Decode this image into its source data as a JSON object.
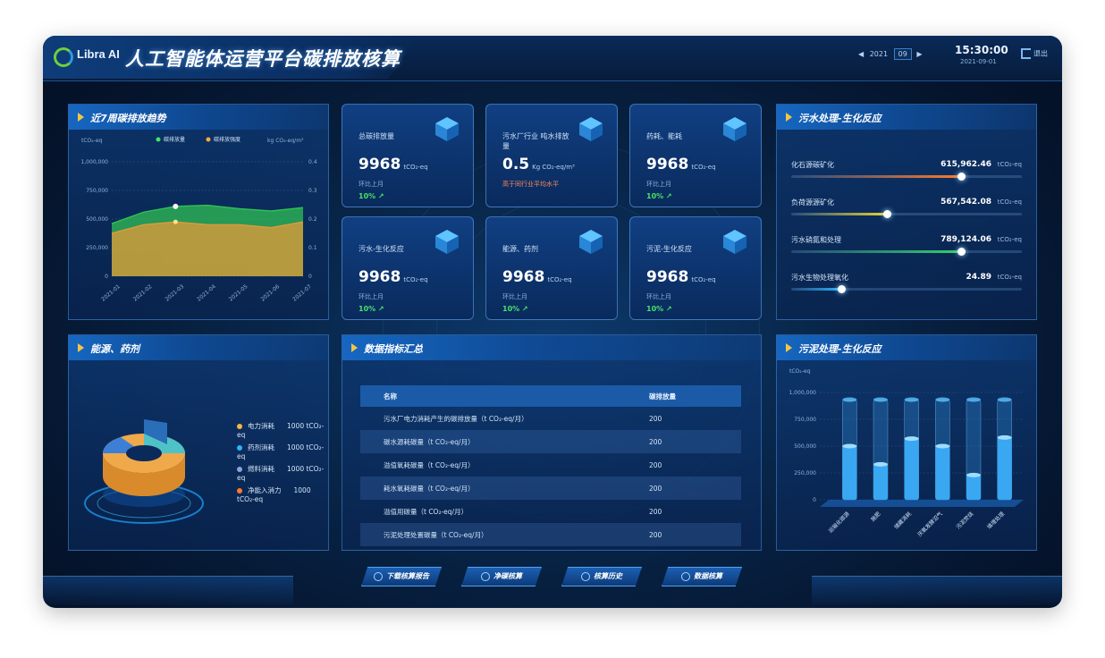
{
  "header": {
    "logo": "Libra AI",
    "title": "人工智能体运营平台碳排放核算",
    "date_prev": "◀",
    "date_year": "2021",
    "date_value": "09",
    "date_next": "▶",
    "time": "15:30:00",
    "date_sub": "2021-09-01",
    "exit_label": "退出"
  },
  "trend": {
    "title": "近7周碳排放趋势",
    "ylabel_left": "tCO₂-eq",
    "ylabel_right": "kg CO₂-eq/m³",
    "legend": [
      "碳排放量",
      "碳排放强度"
    ],
    "y_ticks_left": [
      "1,000,000",
      "750,000",
      "500,000",
      "250,000",
      "0"
    ],
    "y_ticks_right": [
      "0.4",
      "0.3",
      "0.2",
      "0.1",
      "0"
    ]
  },
  "chart_data": {
    "type": "area",
    "categories": [
      "2021-01",
      "2021-02",
      "2021-03",
      "2021-04",
      "2021-05",
      "2021-06",
      "2021-07"
    ],
    "series": [
      {
        "name": "碳排放量",
        "values": [
          460000,
          560000,
          610000,
          620000,
          590000,
          570000,
          600000
        ]
      },
      {
        "name": "碳排放强度",
        "values": [
          0.15,
          0.18,
          0.19,
          0.18,
          0.18,
          0.17,
          0.19
        ]
      }
    ],
    "ylim": [
      0,
      1000000
    ],
    "ylim_right": [
      0,
      0.4
    ]
  },
  "kpis": [
    {
      "label": "总碳排放量",
      "value": "9968",
      "unit": "tCO₂-eq",
      "compare": "环比上月",
      "pct": "10% ↗"
    },
    {
      "label": "污水厂行业 吨水排放量",
      "value": "0.5",
      "unit": "Kg CO₂-eq/m³",
      "compare": "高于同行业平均水平",
      "pct": ""
    },
    {
      "label": "药耗、能耗",
      "value": "9968",
      "unit": "tCO₂-eq",
      "compare": "环比上月",
      "pct": "10% ↗"
    },
    {
      "label": "污水-生化反应",
      "value": "9968",
      "unit": "tCO₂-eq",
      "compare": "环比上月",
      "pct": "10% ↗"
    },
    {
      "label": "能源、药剂",
      "value": "9968",
      "unit": "tCO₂-eq",
      "compare": "环比上月",
      "pct": "10% ↗"
    },
    {
      "label": "污泥-生化反应",
      "value": "9968",
      "unit": "tCO₂-eq",
      "compare": "环比上月",
      "pct": "10% ↗"
    }
  ],
  "water_panel": {
    "title": "污水处理-生化反应",
    "rows": [
      {
        "name": "化石源碳矿化",
        "value": "615,962.46",
        "unit": "tCO₂-eq",
        "fill": 0.74
      },
      {
        "name": "负荷源源矿化",
        "value": "567,542.08",
        "unit": "tCO₂-eq",
        "fill": 0.42
      },
      {
        "name": "污水硝氮和处理",
        "value": "789,124.06",
        "unit": "tCO₂-eq",
        "fill": 0.74
      },
      {
        "name": "污水生物处理氧化",
        "value": "24.89",
        "unit": "tCO₂-eq",
        "fill": 0.22
      }
    ]
  },
  "energy_panel": {
    "title": "能源、药剂",
    "legend": [
      {
        "name": "电力消耗",
        "value": "1000 tCO₂-eq"
      },
      {
        "name": "药剂消耗",
        "value": "1000 tCO₂-eq"
      },
      {
        "name": "燃料消耗",
        "value": "1000 tCO₂-eq"
      },
      {
        "name": "净能入消力",
        "value": "1000 tCO₂-eq"
      }
    ]
  },
  "summary": {
    "title": "数据指标汇总",
    "headers": [
      "名称",
      "碳排放量"
    ],
    "rows": [
      [
        "污水厂电力消耗产生的碳排放量（t CO₂-eq/月）",
        "200"
      ],
      [
        "碳水源耗碳量（t CO₂-eq/月）",
        "200"
      ],
      [
        "溢值氧耗碳量（t CO₂-eq/月）",
        "200"
      ],
      [
        "耗水氧耗碳量（t CO₂-eq/月）",
        "200"
      ],
      [
        "溢值用碳量（t CO₂-eq/月）",
        "200"
      ],
      [
        "污泥处理处置碳量（t CO₂-eq/月）",
        "200"
      ]
    ]
  },
  "sludge_panel": {
    "title": "污泥处理-生化反应",
    "ylabel": "tCO₂-eq",
    "y_ticks": [
      "1,000,000",
      "750,000",
      "500,000",
      "250,000",
      "0"
    ],
    "categories": [
      "运输化碳源",
      "施肥",
      "储藏消耗",
      "厌氧发酵沼气",
      "污泥焚烧",
      "填埋处理"
    ],
    "values": [
      500000,
      330000,
      570000,
      500000,
      230000,
      580000
    ]
  },
  "buttons": [
    "下载核算报告",
    "净碳核算",
    "核算历史",
    "数据核算"
  ],
  "colors": {
    "accent": "#f5c542",
    "green": "#46e06a",
    "bar_orange": "#ff7a2a",
    "bar_yellow": "#e9d233",
    "bar_green": "#33d16a",
    "bar_cyan": "#2ab6ff"
  }
}
